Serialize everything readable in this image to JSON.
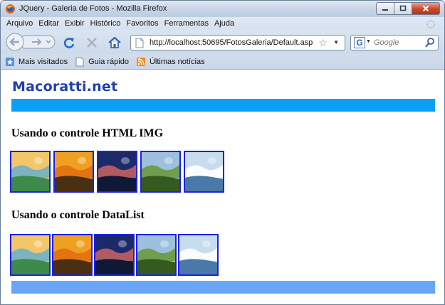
{
  "window": {
    "title": "JQuery - Galeria de Fotos - Mozilla Firefox"
  },
  "menubar": {
    "items": [
      {
        "label": "Arquivo"
      },
      {
        "label": "Editar"
      },
      {
        "label": "Exibir"
      },
      {
        "label": "Histórico"
      },
      {
        "label": "Favoritos"
      },
      {
        "label": "Ferramentas"
      },
      {
        "label": "Ajuda"
      }
    ]
  },
  "navbar": {
    "url": "http://localhost:50695/FotosGaleria/Default.aspx",
    "search_placeholder": "Google"
  },
  "bookmarks": {
    "items": [
      {
        "label": "Mais visitados",
        "icon": "star-page-icon"
      },
      {
        "label": "Guia rápido",
        "icon": "page-icon"
      },
      {
        "label": "Últimas notícias",
        "icon": "rss-feed-icon"
      }
    ]
  },
  "page": {
    "site_title": "Macoratti.net",
    "section_img_title": "Usando o controle HTML IMG",
    "section_datalist_title": "Usando o controle DataList",
    "images": [
      {
        "name": "coast-photo",
        "sky": "#f3c66a",
        "mid": "#6fb0c8",
        "ground": "#3e8a4a"
      },
      {
        "name": "sunset-photo",
        "sky": "#f0a020",
        "mid": "#e07010",
        "ground": "#4a3010"
      },
      {
        "name": "dusk-lake-photo",
        "sky": "#1c2a6a",
        "mid": "#c06060",
        "ground": "#101838"
      },
      {
        "name": "meadow-photo",
        "sky": "#9ec0de",
        "mid": "#6a9a40",
        "ground": "#355a20"
      },
      {
        "name": "snow-lake-photo",
        "sky": "#c8dcf0",
        "mid": "#ffffff",
        "ground": "#4a78a8"
      }
    ]
  },
  "colors": {
    "header_bar": "#0aa0f5",
    "footer_bar": "#69a6fa",
    "site_title": "#1e3fb0",
    "thumb_border": "#1b22e0"
  }
}
